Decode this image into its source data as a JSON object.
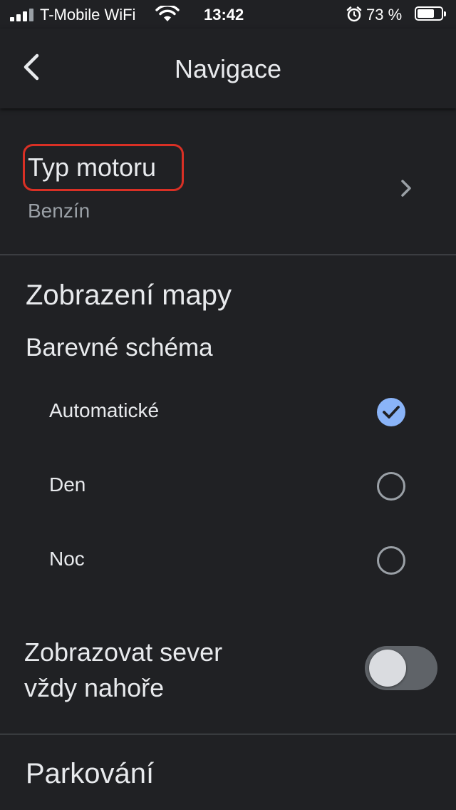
{
  "status_bar": {
    "carrier": "T-Mobile WiFi",
    "time": "13:42",
    "battery": "73 %",
    "battery_level": 0.73
  },
  "header": {
    "title": "Navigace",
    "back_icon": "chevron-left-icon"
  },
  "engine": {
    "title": "Typ motoru",
    "value": "Benzín",
    "highlight_color": "#d93025"
  },
  "map_display": {
    "title": "Zobrazení mapy",
    "color_scheme": {
      "title": "Barevné schéma",
      "options": [
        {
          "label": "Automatické",
          "selected": true
        },
        {
          "label": "Den",
          "selected": false
        },
        {
          "label": "Noc",
          "selected": false
        }
      ]
    },
    "north_up": {
      "line1": "Zobrazovat sever",
      "line2": "vždy nahoře",
      "enabled": false
    }
  },
  "parking": {
    "title": "Parkování"
  },
  "colors": {
    "background": "#202124",
    "accent": "#8ab4f8",
    "secondary_text": "#9aa0a6"
  }
}
